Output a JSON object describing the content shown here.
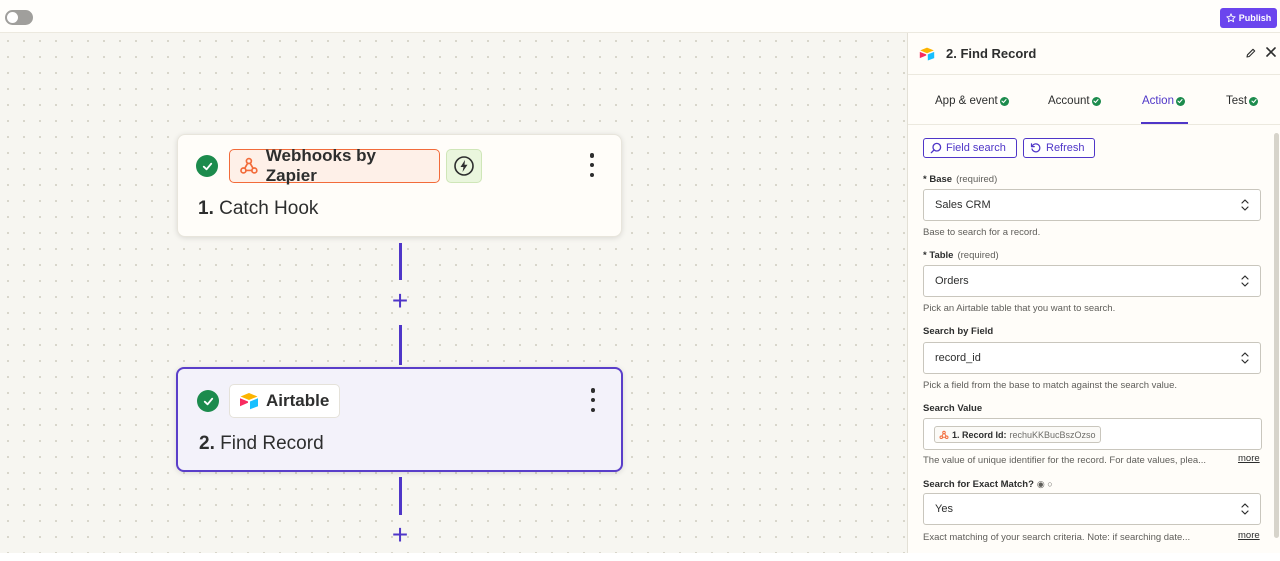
{
  "topbar": {
    "publish_label": "Publish"
  },
  "steps": [
    {
      "number": "1.",
      "title": "Catch Hook",
      "app": "Webhooks by Zapier"
    },
    {
      "number": "2.",
      "title": "Find Record",
      "app": "Airtable"
    }
  ],
  "panel": {
    "title": "2. Find Record",
    "tabs": [
      {
        "label": "App & event"
      },
      {
        "label": "Account"
      },
      {
        "label": "Action"
      },
      {
        "label": "Test"
      }
    ],
    "tools": {
      "field_search": "Field search",
      "refresh": "Refresh"
    },
    "fields": {
      "base": {
        "label": "Base",
        "required": "(required)",
        "value": "Sales CRM",
        "help": "Base to search for a record."
      },
      "table": {
        "label": "Table",
        "required": "(required)",
        "value": "Orders",
        "help": "Pick an Airtable table that you want to search."
      },
      "search_by_field": {
        "label": "Search by Field",
        "value": "record_id",
        "help": "Pick a field from the base to match against the search value."
      },
      "search_value": {
        "label": "Search Value",
        "token_label": "1. Record Id:",
        "token_value": "rechuKKBucBszOzso",
        "help": "The value of unique identifier for the record. For date values, plea...",
        "more": "more"
      },
      "exact_match": {
        "label": "Search for Exact Match?",
        "value": "Yes",
        "help": "Exact matching of your search criteria. Note: if searching date...",
        "more": "more"
      }
    }
  }
}
